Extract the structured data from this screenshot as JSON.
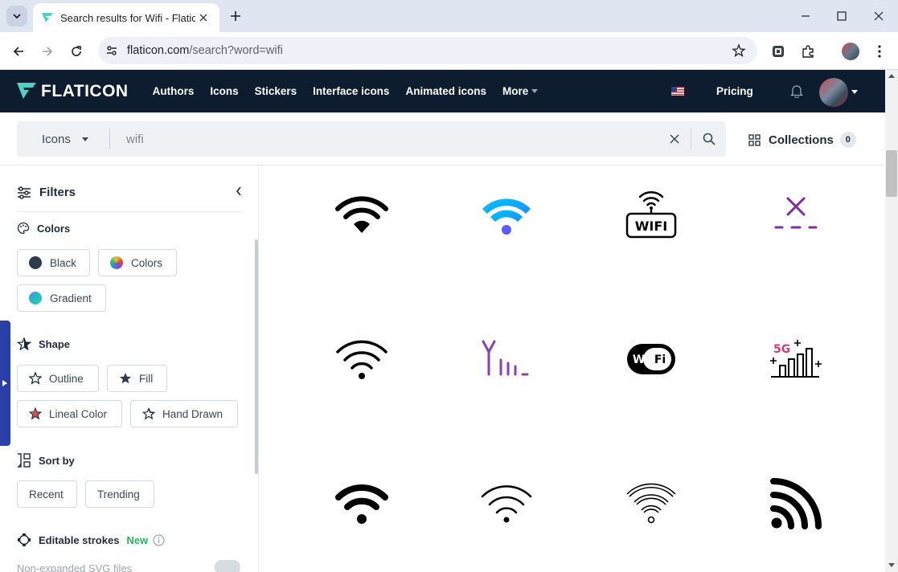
{
  "browser": {
    "tab_title": "Search results for Wifi - Flaticon",
    "url_host": "flaticon.com",
    "url_path": "/search?word=wifi"
  },
  "header": {
    "logo": "FLATICON",
    "nav": [
      "Authors",
      "Icons",
      "Stickers",
      "Interface icons",
      "Animated icons",
      "More"
    ],
    "pricing": "Pricing"
  },
  "search": {
    "type": "Icons",
    "query": "wifi",
    "collections_label": "Collections",
    "collections_count": "0"
  },
  "filters": {
    "title": "Filters",
    "colors": {
      "title": "Colors",
      "options": [
        "Black",
        "Colors",
        "Gradient"
      ]
    },
    "shape": {
      "title": "Shape",
      "options": [
        "Outline",
        "Fill",
        "Lineal Color",
        "Hand Drawn"
      ]
    },
    "sort": {
      "title": "Sort by",
      "options": [
        "Recent",
        "Trending"
      ]
    },
    "editable": {
      "title": "Editable strokes",
      "badge": "New",
      "option": "Non-expanded SVG files"
    }
  },
  "results": {
    "icons": [
      "wifi-black-icon",
      "wifi-gradient-icon",
      "wifi-sign-icon",
      "no-wifi-icon",
      "wifi-outline-icon",
      "antenna-signal-icon",
      "wifi-badge-icon",
      "5g-signal-icon",
      "wifi-bold-icon",
      "wifi-thin-icon",
      "wifi-outline-double-icon",
      "rss-feed-icon"
    ],
    "wifi_sign_text": "WIFI",
    "wifi_badge_left": "Wi",
    "wifi_badge_right": "Fi",
    "fiveg_text": "5G"
  },
  "colors": {
    "header_bg": "#0e1c2f",
    "logo_accent": "#4fd1c5",
    "gradient_start": "#00c2ff",
    "gradient_end": "#6a3dff",
    "purple": "#7b2fa0",
    "pink": "#d63a72",
    "new_badge": "#1fb85c"
  }
}
